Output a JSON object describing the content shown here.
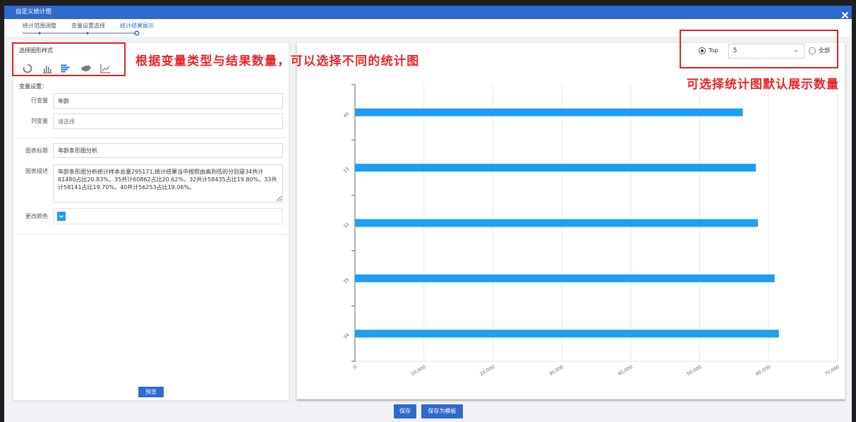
{
  "dialog": {
    "title": "自定义统计图"
  },
  "steps": [
    {
      "label": "统计范围调整",
      "active": false
    },
    {
      "label": "变量设置选择",
      "active": false
    },
    {
      "label": "统计结果展示",
      "active": true
    }
  ],
  "chart_style": {
    "label": "选择图形样式",
    "options": [
      {
        "icon": "donut-chart-icon",
        "selected": false
      },
      {
        "icon": "bar-chart-icon",
        "selected": false
      },
      {
        "icon": "horizontal-bar-chart-icon",
        "selected": true
      },
      {
        "icon": "map-chart-icon",
        "selected": false
      },
      {
        "icon": "line-chart-icon",
        "selected": false
      }
    ]
  },
  "variables": {
    "section_label": "变量设置：",
    "row": {
      "label": "行变量",
      "value": "年龄"
    },
    "column": {
      "label": "列变量",
      "placeholder": "请选择"
    }
  },
  "chart_settings": {
    "title": {
      "label": "图表标题",
      "value": "年龄条形图分析"
    },
    "description": {
      "label": "图表描述",
      "value": "年龄条形图分析统计样本总量295171,统计结果当中按照由高到低的分别是34共计61480占比20.83%，35共计60862占比20.62%，32共计58435占比19.80%，33共计58141占比19.70%，40共计56253占比19.06%。"
    },
    "color": {
      "label": "更改颜色",
      "value": "#1e9ff2"
    }
  },
  "preview_button": "预览",
  "display_count": {
    "top_label": "Top",
    "top_selected": true,
    "top_value": "5",
    "all_label": "全部",
    "all_selected": false
  },
  "annotations": {
    "chart_type_hint": "根据变量类型与结果数量，可以选择不同的统计图",
    "display_count_hint": "可选择统计图默认展示数量"
  },
  "chart_data": {
    "type": "bar",
    "orientation": "horizontal",
    "categories": [
      "40",
      "33",
      "32",
      "35",
      "34"
    ],
    "values": [
      56253,
      58141,
      58435,
      60862,
      61480
    ],
    "xlim": [
      0,
      70000
    ],
    "xticks": [
      0,
      10000,
      20000,
      30000,
      40000,
      50000,
      60000,
      70000
    ],
    "xtick_labels": [
      "0",
      "10,000",
      "20,000",
      "30,000",
      "40,000",
      "50,000",
      "60,000",
      "70,000"
    ],
    "grid": true,
    "color": "#1e9ff2"
  },
  "footer": {
    "save_button": "保存",
    "save_template_button": "保存为模板"
  },
  "colors": {
    "primary": "#2d6acd",
    "annotation": "#e8262a",
    "bar": "#1e9ff2"
  }
}
